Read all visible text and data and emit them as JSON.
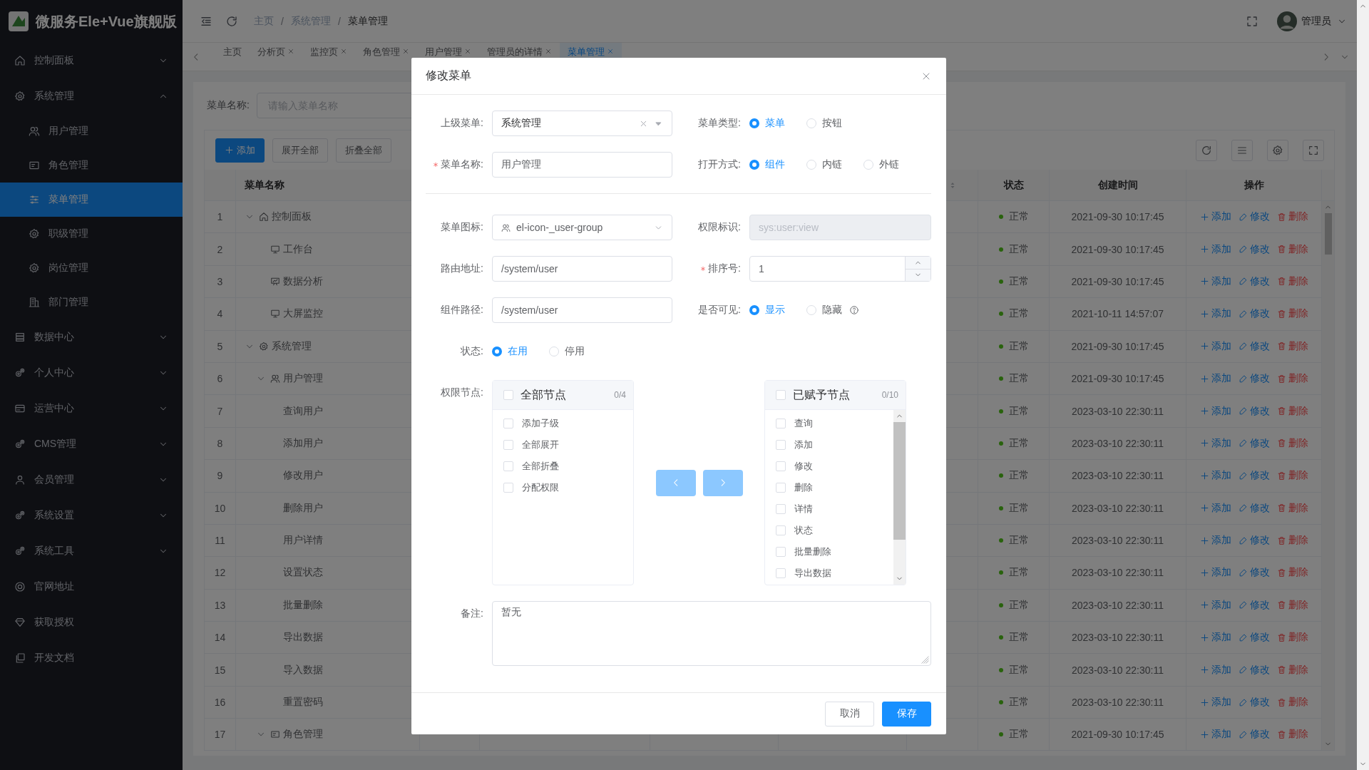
{
  "app": {
    "title": "微服务Ele+Vue旗舰版"
  },
  "sidebar": {
    "items": [
      {
        "label": "控制面板",
        "kind": "group",
        "expanded": false,
        "selected": false
      },
      {
        "label": "系统管理",
        "kind": "group",
        "expanded": true,
        "selected": false,
        "children": [
          {
            "label": "用户管理",
            "selected": false
          },
          {
            "label": "角色管理",
            "selected": false
          },
          {
            "label": "菜单管理",
            "selected": true
          },
          {
            "label": "职级管理",
            "selected": false
          },
          {
            "label": "岗位管理",
            "selected": false
          },
          {
            "label": "部门管理",
            "selected": false
          }
        ]
      },
      {
        "label": "数据中心",
        "kind": "group",
        "expanded": false,
        "selected": false
      },
      {
        "label": "个人中心",
        "kind": "group",
        "expanded": false,
        "selected": false
      },
      {
        "label": "运营中心",
        "kind": "group",
        "expanded": false,
        "selected": false
      },
      {
        "label": "CMS管理",
        "kind": "group",
        "expanded": false,
        "selected": false
      },
      {
        "label": "会员管理",
        "kind": "group",
        "expanded": false,
        "selected": false
      },
      {
        "label": "系统设置",
        "kind": "group",
        "expanded": false,
        "selected": false
      },
      {
        "label": "系统工具",
        "kind": "group",
        "expanded": false,
        "selected": false
      },
      {
        "label": "官网地址",
        "kind": "link",
        "selected": false
      },
      {
        "label": "获取授权",
        "kind": "link",
        "selected": false
      },
      {
        "label": "开发文档",
        "kind": "link",
        "selected": false
      }
    ]
  },
  "header": {
    "breadcrumb": [
      {
        "label": "主页",
        "separator": "/"
      },
      {
        "label": "系统管理",
        "separator": "/"
      },
      {
        "label": "菜单管理"
      }
    ],
    "user": "管理员"
  },
  "tabs": [
    {
      "label": "主页",
      "closable": false,
      "selected": false
    },
    {
      "label": "分析页",
      "closable": true,
      "selected": false
    },
    {
      "label": "监控页",
      "closable": true,
      "selected": false
    },
    {
      "label": "角色管理",
      "closable": true,
      "selected": false
    },
    {
      "label": "用户管理",
      "closable": true,
      "selected": false
    },
    {
      "label": "管理员的详情",
      "closable": true,
      "selected": false
    },
    {
      "label": "菜单管理",
      "closable": true,
      "selected": true
    }
  ],
  "search": {
    "label": "菜单名称:",
    "placeholder": "请输入菜单名称"
  },
  "toolbar": {
    "buttons": [
      {
        "label": "添加",
        "kind": "primary"
      },
      {
        "label": "展开全部",
        "kind": "default"
      },
      {
        "label": "折叠全部",
        "kind": "default"
      }
    ]
  },
  "table": {
    "headers": {
      "name": "菜单名称",
      "status": "状态",
      "created": "创建时间",
      "actions": "操作"
    },
    "rows": [
      {
        "index": "1",
        "name": "控制面板",
        "kind": "menu",
        "expanded": true,
        "status": "正常",
        "created": "2021-09-30 10:17:45",
        "actions": [
          "添加",
          "修改",
          "删除"
        ],
        "children": [
          {
            "index": "2",
            "name": "工作台",
            "kind": "menu",
            "status": "正常",
            "created": "2021-09-30 10:17:45",
            "actions": [
              "添加",
              "修改",
              "删除"
            ]
          },
          {
            "index": "3",
            "name": "数据分析",
            "kind": "menu",
            "status": "正常",
            "created": "2021-09-30 10:17:45",
            "actions": [
              "添加",
              "修改",
              "删除"
            ]
          },
          {
            "index": "4",
            "name": "大屏监控",
            "kind": "menu",
            "status": "正常",
            "created": "2021-10-11 14:57:07",
            "actions": [
              "添加",
              "修改",
              "删除"
            ]
          }
        ]
      },
      {
        "index": "5",
        "name": "系统管理",
        "kind": "menu",
        "expanded": true,
        "status": "正常",
        "created": "2021-09-30 10:17:45",
        "actions": [
          "添加",
          "修改",
          "删除"
        ],
        "children": [
          {
            "index": "6",
            "name": "用户管理",
            "kind": "menu",
            "expanded": true,
            "status": "正常",
            "created": "2021-09-30 10:17:45",
            "actions": [
              "添加",
              "修改",
              "删除"
            ],
            "children": [
              {
                "index": "7",
                "name": "查询用户",
                "kind": "button",
                "status": "正常",
                "created": "2023-03-10 22:30:11",
                "actions": [
                  "添加",
                  "修改",
                  "删除"
                ]
              },
              {
                "index": "8",
                "name": "添加用户",
                "kind": "button",
                "status": "正常",
                "created": "2023-03-10 22:30:11",
                "actions": [
                  "添加",
                  "修改",
                  "删除"
                ]
              },
              {
                "index": "9",
                "name": "修改用户",
                "kind": "button",
                "status": "正常",
                "created": "2023-03-10 22:30:11",
                "actions": [
                  "添加",
                  "修改",
                  "删除"
                ]
              },
              {
                "index": "10",
                "name": "删除用户",
                "kind": "button",
                "status": "正常",
                "created": "2023-03-10 22:30:11",
                "actions": [
                  "添加",
                  "修改",
                  "删除"
                ]
              },
              {
                "index": "11",
                "name": "用户详情",
                "kind": "button",
                "status": "正常",
                "created": "2023-03-10 22:30:11",
                "actions": [
                  "添加",
                  "修改",
                  "删除"
                ]
              },
              {
                "index": "12",
                "name": "设置状态",
                "kind": "button",
                "status": "正常",
                "created": "2023-03-10 22:30:11",
                "actions": [
                  "添加",
                  "修改",
                  "删除"
                ]
              },
              {
                "index": "13",
                "name": "批量删除",
                "kind": "button",
                "status": "正常",
                "created": "2023-03-10 22:30:11",
                "actions": [
                  "添加",
                  "修改",
                  "删除"
                ]
              },
              {
                "index": "14",
                "name": "导出数据",
                "kind": "button",
                "status": "正常",
                "created": "2023-03-10 22:30:11",
                "actions": [
                  "添加",
                  "修改",
                  "删除"
                ]
              },
              {
                "index": "15",
                "name": "导入数据",
                "kind": "button",
                "status": "正常",
                "created": "2023-03-10 22:30:11",
                "actions": [
                  "添加",
                  "修改",
                  "删除"
                ]
              },
              {
                "index": "16",
                "name": "重置密码",
                "kind": "button",
                "status": "正常",
                "created": "2023-03-10 22:30:11",
                "actions": [
                  "添加",
                  "修改",
                  "删除"
                ]
              }
            ]
          },
          {
            "index": "17",
            "name": "角色管理",
            "kind": "menu",
            "expanded": true,
            "status": "正常",
            "created": "2021-09-30 10:17:45",
            "actions": [
              "添加",
              "修改",
              "删除"
            ]
          }
        ]
      }
    ]
  },
  "dialog": {
    "title": "修改菜单",
    "parent_menu": {
      "label": "上级菜单:",
      "value": "系统管理"
    },
    "menu_type": {
      "label": "菜单类型:",
      "options": [
        {
          "label": "菜单",
          "selected": true
        },
        {
          "label": "按钮",
          "selected": false
        }
      ]
    },
    "menu_name": {
      "label": "菜单名称:",
      "required": true,
      "value": "用户管理"
    },
    "open_mode": {
      "label": "打开方式:",
      "options": [
        {
          "label": "组件",
          "selected": true
        },
        {
          "label": "内链",
          "selected": false
        },
        {
          "label": "外链",
          "selected": false
        }
      ]
    },
    "menu_icon": {
      "label": "菜单图标:",
      "value": "el-icon-_user-group"
    },
    "permission": {
      "label": "权限标识:",
      "placeholder": "sys:user:view",
      "disabled": true
    },
    "route": {
      "label": "路由地址:",
      "value": "/system/user"
    },
    "sort": {
      "label": "排序号:",
      "required": true,
      "value": "1"
    },
    "component": {
      "label": "组件路径:",
      "value": "/system/user"
    },
    "visible": {
      "label": "是否可见:",
      "options": [
        {
          "label": "显示",
          "selected": true
        },
        {
          "label": "隐藏",
          "selected": false
        }
      ]
    },
    "status": {
      "label": "状态:",
      "options": [
        {
          "label": "在用",
          "selected": true
        },
        {
          "label": "停用",
          "selected": false
        }
      ]
    },
    "nodes": {
      "label": "权限节点:",
      "source": {
        "title": "全部节点",
        "count": "0/4",
        "checked": false,
        "items": [
          {
            "label": "添加子级",
            "checked": false
          },
          {
            "label": "全部展开",
            "checked": false
          },
          {
            "label": "全部折叠",
            "checked": false
          },
          {
            "label": "分配权限",
            "checked": false
          }
        ]
      },
      "target": {
        "title": "已赋予节点",
        "count": "0/10",
        "checked": false,
        "items": [
          {
            "label": "查询",
            "checked": false
          },
          {
            "label": "添加",
            "checked": false
          },
          {
            "label": "修改",
            "checked": false
          },
          {
            "label": "删除",
            "checked": false
          },
          {
            "label": "详情",
            "checked": false
          },
          {
            "label": "状态",
            "checked": false
          },
          {
            "label": "批量删除",
            "checked": false
          },
          {
            "label": "导出数据",
            "checked": false
          }
        ]
      }
    },
    "remark": {
      "label": "备注:",
      "value": "暂无"
    },
    "buttons": [
      {
        "label": "取消",
        "kind": "default"
      },
      {
        "label": "保存",
        "kind": "primary"
      }
    ]
  }
}
